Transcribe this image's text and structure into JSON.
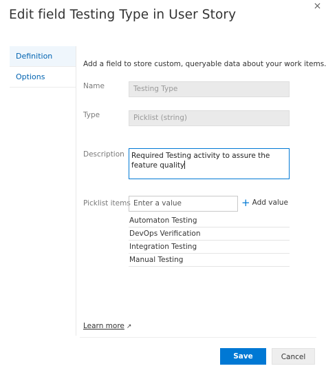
{
  "dialog": {
    "title": "Edit field Testing Type in User Story",
    "close_icon": "close-icon"
  },
  "sidebar": {
    "items": [
      {
        "label": "Definition",
        "active": true
      },
      {
        "label": "Options",
        "active": false
      }
    ]
  },
  "definition": {
    "intro": "Add a field to store custom, queryable data about your work items.",
    "name": {
      "label": "Name",
      "value": "Testing Type"
    },
    "type": {
      "label": "Type",
      "value": "Picklist (string)"
    },
    "description": {
      "label": "Description",
      "value": "Required Testing activity to assure the feature quality"
    },
    "picklist": {
      "label": "Picklist items",
      "input_placeholder": "Enter a value",
      "add_label": "Add value",
      "items": [
        "Automaton Testing",
        "DevOps Verification",
        "Integration Testing",
        "Manual Testing"
      ]
    },
    "learn_more": "Learn more"
  },
  "footer": {
    "save_label": "Save",
    "cancel_label": "Cancel"
  },
  "colors": {
    "accent": "#0078d4",
    "link": "#0063b1",
    "readonly_bg": "#eaeaea"
  }
}
